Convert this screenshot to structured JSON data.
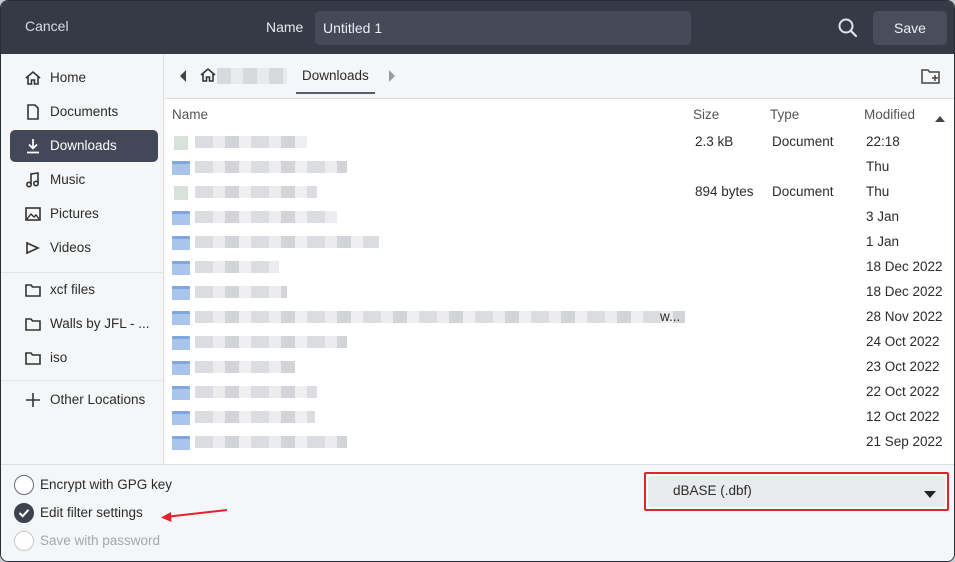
{
  "header": {
    "cancel_label": "Cancel",
    "name_label": "Name",
    "name_value": "Untitled 1",
    "search_icon": "search-icon",
    "save_label": "Save"
  },
  "sidebar": {
    "items": [
      {
        "label": "Home",
        "icon": "home-icon"
      },
      {
        "label": "Documents",
        "icon": "document-icon"
      },
      {
        "label": "Downloads",
        "icon": "download-icon",
        "active": true
      },
      {
        "label": "Music",
        "icon": "music-icon"
      },
      {
        "label": "Pictures",
        "icon": "picture-icon"
      },
      {
        "label": "Videos",
        "icon": "video-icon"
      },
      {
        "label": "xcf files",
        "icon": "folder-icon"
      },
      {
        "label": "Walls by JFL - ...",
        "icon": "folder-icon"
      },
      {
        "label": "iso",
        "icon": "folder-icon"
      },
      {
        "label": "Other Locations",
        "icon": "plus-icon"
      }
    ]
  },
  "pathbar": {
    "current": "Downloads"
  },
  "filelist": {
    "columns": {
      "name": "Name",
      "size": "Size",
      "type": "Type",
      "modified": "Modified"
    },
    "sort": "modified-descending",
    "rows": [
      {
        "size": "2.3 kB",
        "type": "Document",
        "modified": "22:18",
        "kind": "doc"
      },
      {
        "size": "",
        "type": "",
        "modified": "Thu",
        "kind": "folder"
      },
      {
        "size": "894 bytes",
        "type": "Document",
        "modified": "Thu",
        "kind": "doc"
      },
      {
        "size": "",
        "type": "",
        "modified": "3 Jan",
        "kind": "folder"
      },
      {
        "size": "",
        "type": "",
        "modified": "1 Jan",
        "kind": "folder"
      },
      {
        "size": "",
        "type": "",
        "modified": "18 Dec 2022",
        "kind": "folder"
      },
      {
        "size": "",
        "type": "",
        "modified": "18 Dec 2022",
        "kind": "folder"
      },
      {
        "size": "",
        "type": "",
        "modified": "28 Nov 2022",
        "kind": "folder",
        "trail": "w..."
      },
      {
        "size": "",
        "type": "",
        "modified": "24 Oct 2022",
        "kind": "folder"
      },
      {
        "size": "",
        "type": "",
        "modified": "23 Oct 2022",
        "kind": "folder"
      },
      {
        "size": "",
        "type": "",
        "modified": "22 Oct 2022",
        "kind": "folder"
      },
      {
        "size": "",
        "type": "",
        "modified": "12 Oct 2022",
        "kind": "folder"
      },
      {
        "size": "",
        "type": "",
        "modified": "21 Sep 2022",
        "kind": "folder"
      }
    ]
  },
  "options": {
    "encrypt_label": "Encrypt with GPG key",
    "encrypt_checked": false,
    "filter_label": "Edit filter settings",
    "filter_checked": true,
    "password_label": "Save with password",
    "password_enabled": false
  },
  "filetype": {
    "selected": "dBASE (.dbf)"
  },
  "colors": {
    "header_bg": "#363a47",
    "active_sidebar_bg": "#434858",
    "highlight_red": "#e0242f"
  }
}
